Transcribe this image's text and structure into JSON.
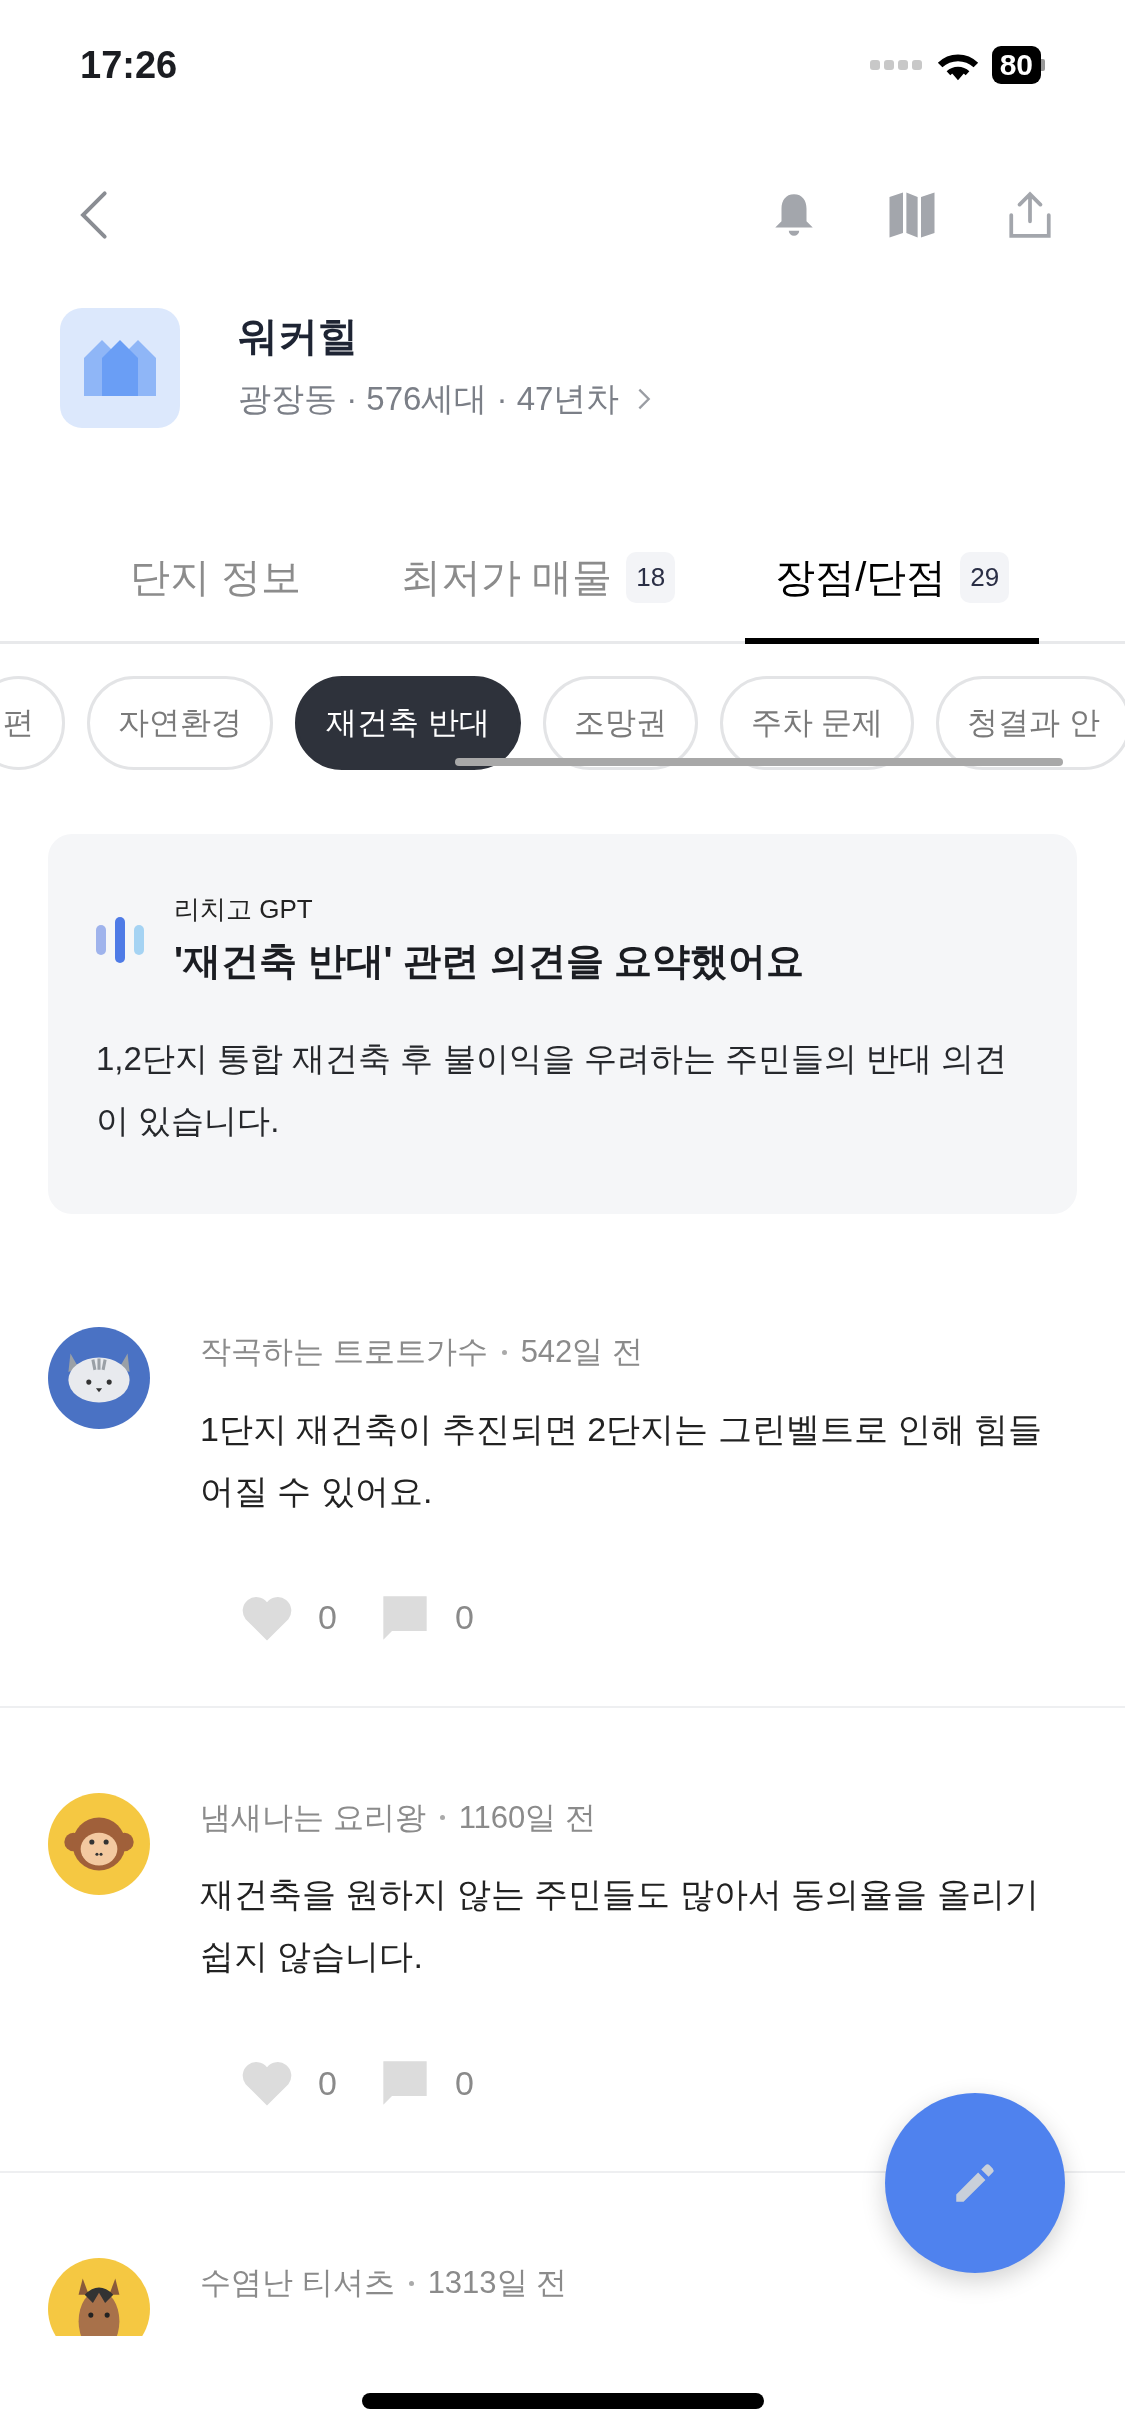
{
  "status_bar": {
    "time": "17:26",
    "battery": "80"
  },
  "complex": {
    "name": "워커힐",
    "details": "광장동 · 576세대 · 47년차"
  },
  "tabs": [
    {
      "label": "단지 정보",
      "selected": false
    },
    {
      "label": "최저가 매물",
      "count": "18",
      "selected": false
    },
    {
      "label": "장점/단점",
      "count": "29",
      "selected": true
    }
  ],
  "chips": [
    {
      "label": "편",
      "selected": false
    },
    {
      "label": "자연환경",
      "selected": false
    },
    {
      "label": "재건축 반대",
      "selected": true
    },
    {
      "label": "조망권",
      "selected": false
    },
    {
      "label": "주차 문제",
      "selected": false
    },
    {
      "label": "청결과 안",
      "selected": false
    }
  ],
  "summary": {
    "source": "리치고 GPT",
    "title": "'재건축 반대' 관련 의견을 요약했어요",
    "body": "1,2단지 통합 재건축 후 불이익을 우려하는 주민들의 반대 의견이 있습니다."
  },
  "comments": [
    {
      "kind": "cat",
      "color": "#4a72c4",
      "author": "작곡하는 트로트가수",
      "time": "542일 전",
      "text": "1단지 재건축이 추진되면 2단지는 그린벨트로 인해 힘들어질 수 있어요.",
      "likes": "0",
      "replies": "0"
    },
    {
      "kind": "monkey",
      "color": "#f5c842",
      "author": "냄새나는 요리왕",
      "time": "1160일 전",
      "text": "재건축을 원하지 않는 주민들도 많아서 동의율을 올리기 쉽지 않습니다.",
      "likes": "0",
      "replies": "0"
    },
    {
      "kind": "horse",
      "color": "#f5c842",
      "author": "수염난 티셔츠",
      "time": "1313일 전"
    }
  ]
}
